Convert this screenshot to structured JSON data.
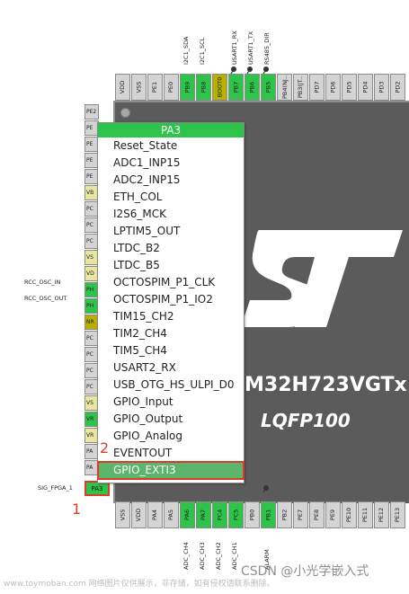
{
  "colors": {
    "accent": "#2ec44a",
    "highlight_outline": "#e03a2a",
    "chip_body": "#5b5b5b"
  },
  "chip": {
    "name": "M32H723VGTx",
    "package": "LQFP100"
  },
  "top_pins": [
    "VDD",
    "VSS",
    "PE1",
    "PE0",
    "PB9",
    "PB8",
    "BOOT0",
    "PB7",
    "PB6",
    "PB5",
    "PB4(NJ..",
    "PB3(JT..",
    "PD7",
    "PD6",
    "PD5",
    "PD4",
    "PD3",
    "PD2"
  ],
  "top_labels": [
    "I2C1_SDA",
    "I2C1_SCL",
    "USART1_RX",
    "USART1_TX",
    "RS485_DIR"
  ],
  "left_pins": [
    "PE2",
    "PE",
    "PE",
    "PE",
    "PE",
    "VB",
    "PC",
    "PC",
    "PC",
    "VS",
    "VD",
    "PH",
    "PH",
    "NR",
    "PC",
    "PC",
    "PC",
    "PC",
    "VS",
    "VR",
    "VR",
    "PA",
    "PA",
    "PA"
  ],
  "left_labels": {
    "osc_in": "RCC_OSC_IN",
    "osc_out": "RCC_OSC_OUT",
    "sig": "SIG_FPGA_1",
    "pa3": "PA3"
  },
  "bottom_pins": [
    "VSS",
    "VDD",
    "PA4",
    "PA5",
    "PA6",
    "PA7",
    "PC4",
    "PC5",
    "PB0",
    "PB1",
    "PB2",
    "PE7",
    "PE8",
    "PE9",
    "PE10",
    "PE11",
    "PE12",
    "PE13",
    "PE14"
  ],
  "bottom_labels": [
    "ADC_CH4",
    "ADC_CH3",
    "ADC_CH2",
    "ADC_CH1",
    "ALARM"
  ],
  "menu": {
    "title": "PA3",
    "items": [
      "Reset_State",
      "ADC1_INP15",
      "ADC2_INP15",
      "ETH_COL",
      "I2S6_MCK",
      "LPTIM5_OUT",
      "LTDC_B2",
      "LTDC_B5",
      "OCTOSPIM_P1_CLK",
      "OCTOSPIM_P1_IO2",
      "TIM15_CH2",
      "TIM2_CH4",
      "TIM5_CH4",
      "USART2_RX",
      "USB_OTG_HS_ULPI_D0",
      "GPIO_Input",
      "GPIO_Output",
      "GPIO_Analog",
      "EVENTOUT",
      "GPIO_EXTI3"
    ],
    "selected": "GPIO_EXTI3"
  },
  "annotations": {
    "step1": "1",
    "step2": "2"
  },
  "watermarks": {
    "bottom_url": "www.toymoban.com 网络图片仅供展示，非存储，如有侵权请联系删除。",
    "csdn": "CSDN @小光学嵌入式"
  },
  "icons": {
    "pin_marker": "pushpin-icon",
    "logo": "st-logo"
  }
}
